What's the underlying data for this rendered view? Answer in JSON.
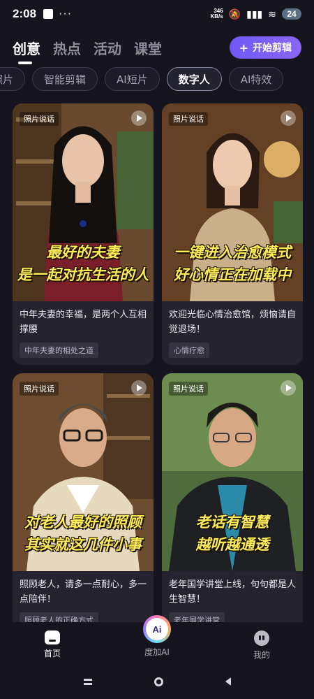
{
  "status": {
    "time": "2:08",
    "dots": "···",
    "net_rate": "346",
    "net_unit": "KB/s",
    "signal": "5G",
    "battery": "24"
  },
  "topnav": {
    "tabs": [
      "创意",
      "热点",
      "活动",
      "课堂"
    ],
    "active_index": 0,
    "start_button": "开始剪辑",
    "start_icon": "+"
  },
  "categories": {
    "items": [
      "照片",
      "智能剪辑",
      "AI短片",
      "数字人",
      "AI特效"
    ],
    "active": "数字人"
  },
  "cards": [
    {
      "tag": "照片说话",
      "caption_line1": "最好的夫妻",
      "caption_line2": "是一起对抗生活的人",
      "description": "中年夫妻的幸福，是两个人互相撑腰",
      "topic": "中年夫妻的相处之道"
    },
    {
      "tag": "照片说话",
      "caption_line1": "一键进入治愈模式",
      "caption_line2": "好心情正在加载中",
      "description": "欢迎光临心情治愈馆，烦恼请自觉退场！",
      "topic": "心情疗愈"
    },
    {
      "tag": "照片说话",
      "caption_line1": "对老人最好的照顾",
      "caption_line2": "其实就这几件小事",
      "description": "照顾老人，请多一点耐心，多一点陪伴！",
      "topic": "照顾老人的正确方式"
    },
    {
      "tag": "照片说话",
      "caption_line1": "老话有智慧",
      "caption_line2": "越听越通透",
      "description": "老年国学讲堂上线，句句都是人生智慧！",
      "topic": "老年国学讲堂"
    }
  ],
  "bottomnav": {
    "home": "首页",
    "ai": "度加AI",
    "ai_badge": "Ai",
    "me": "我的"
  }
}
